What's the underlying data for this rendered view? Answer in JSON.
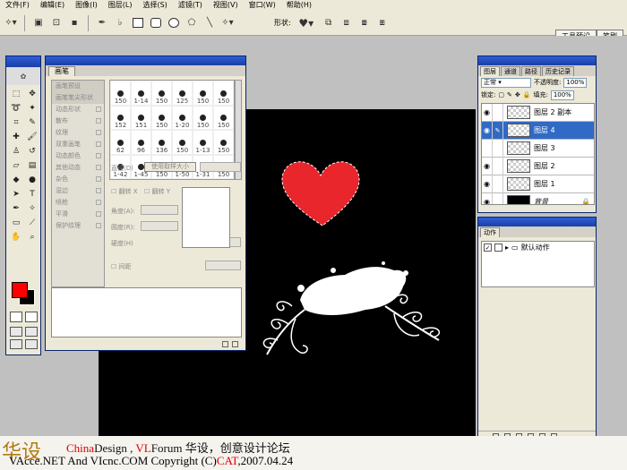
{
  "menu": [
    "文件(F)",
    "编辑(E)",
    "图像(I)",
    "图层(L)",
    "选择(S)",
    "滤镜(T)",
    "视图(V)",
    "窗口(W)",
    "帮助(H)"
  ],
  "options_bar": {
    "shape_label": "形状:"
  },
  "palette_well": {
    "tab1": "工具预设",
    "tab2": "笔刷"
  },
  "brushes_panel": {
    "tab": "画笔",
    "left_items": [
      "画笔预设",
      "画笔笔尖形状",
      "动态形状",
      "散布",
      "纹理",
      "双重画笔",
      "动态颜色",
      "其他动态",
      "杂色",
      "湿边",
      "喷枪",
      "平滑",
      "保护纹理"
    ],
    "sizes": [
      "150",
      "1-14",
      "150",
      "125",
      "150",
      "150",
      "152",
      "151",
      "150",
      "1-20",
      "150",
      "150",
      "62",
      "96",
      "136",
      "150",
      "1-13",
      "150",
      "1-42",
      "1-45",
      "150",
      "1-50",
      "1-31",
      "150"
    ],
    "diameter_label": "直径(D)",
    "use_sample_size": "使用取样大小",
    "flip_x": "翻转 X",
    "flip_y": "翻转 Y",
    "angle": "角度(A):",
    "roundness": "圆度(R):",
    "hardness": "硬度(H)",
    "spacing": "间距"
  },
  "layers_panel": {
    "tabs": [
      "图层",
      "通道",
      "路径",
      "历史记录"
    ],
    "blend_mode": "正常",
    "opacity_label": "不透明度:",
    "opacity": "100%",
    "lock_label": "锁定:",
    "fill_label": "填充:",
    "fill": "100%",
    "layers": [
      {
        "name": "图层 2 副本"
      },
      {
        "name": "图层 4"
      },
      {
        "name": "图层 3"
      },
      {
        "name": "图层 2"
      },
      {
        "name": "图层 1"
      },
      {
        "name": "背景"
      }
    ]
  },
  "actions_panel": {
    "tab": "动作",
    "item": "默认动作"
  },
  "footer": {
    "china": "China",
    "design": "Design",
    "vl": "VL",
    "forum": "Forum",
    "slogan": "华设，创意设计论坛",
    "line2_a": "VAcce.NET  And  VIcnc.COM  Copyright (C)",
    "cat": "CAT",
    "date": ",2007.04.24"
  },
  "colors": {
    "foreground": "#ff0000",
    "background": "#000000",
    "heart": "#e8262b",
    "selection": "#316ac5"
  }
}
